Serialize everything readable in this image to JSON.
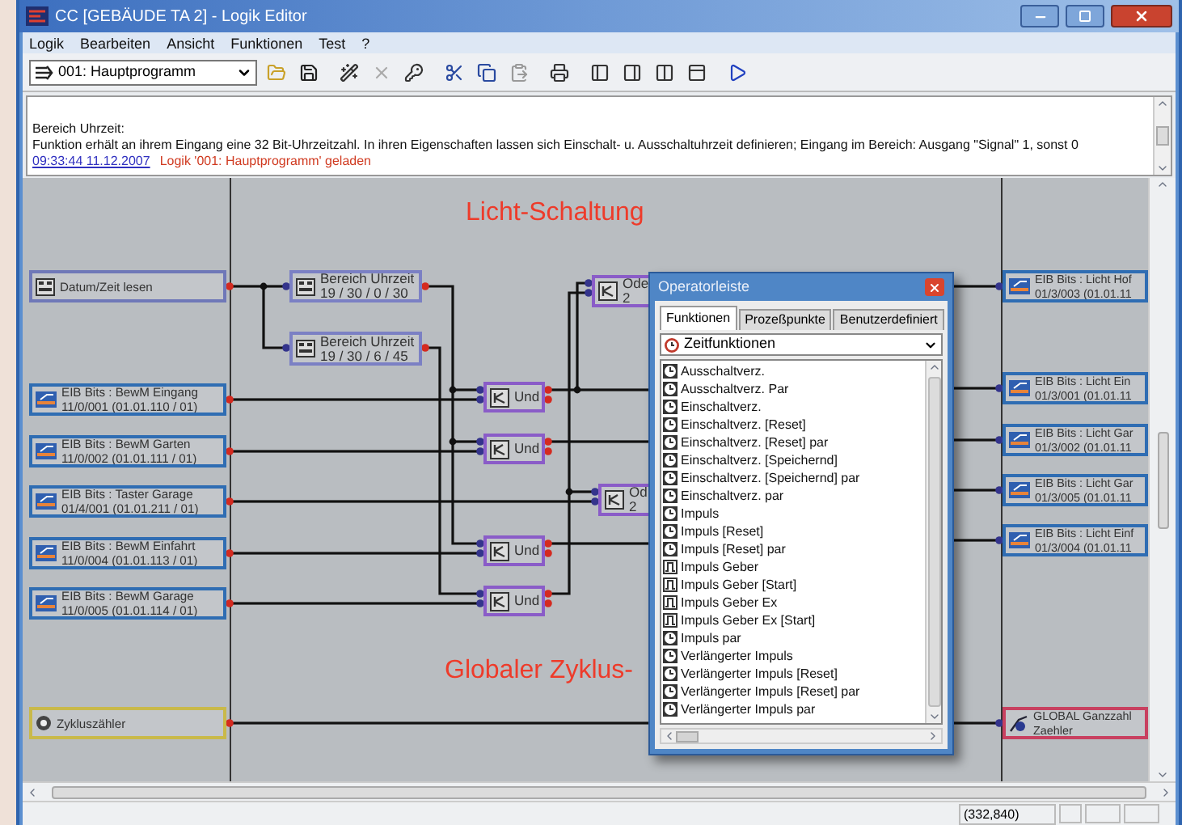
{
  "window": {
    "title": "CC [GEBÄUDE TA 2] - Logik Editor"
  },
  "menu": [
    "Logik",
    "Bearbeiten",
    "Ansicht",
    "Funktionen",
    "Test",
    "?"
  ],
  "toolbar": {
    "program": "001: Hauptprogramm"
  },
  "messages": {
    "heading": "Bereich Uhrzeit:",
    "description": "Funktion erhält an ihrem Eingang eine 32 Bit-Uhrzeitzahl. In ihren Eigenschaften lassen sich Einschalt- u. Ausschaltuhrzeit definieren; Eingang im Bereich: Ausgang \"Signal\" 1, sonst 0",
    "log": [
      {
        "time": "09:33:44 11.12.2007",
        "text": "Logik '001: Hauptprogramm' geladen"
      }
    ]
  },
  "diagram": {
    "section_labels": [
      "Licht-Schaltung",
      "Globaler Zyklus-"
    ],
    "inputs": [
      {
        "kind": "datetime",
        "lines": [
          "Datum/Zeit lesen"
        ]
      },
      {
        "kind": "eib",
        "lines": [
          "EIB Bits : BewM Eingang",
          "11/0/001 (01.01.110 / 01)"
        ]
      },
      {
        "kind": "eib",
        "lines": [
          "EIB Bits : BewM Garten",
          "11/0/002 (01.01.111 / 01)"
        ]
      },
      {
        "kind": "eib",
        "lines": [
          "EIB Bits : Taster Garage",
          "01/4/001 (01.01.211 / 01)"
        ]
      },
      {
        "kind": "eib",
        "lines": [
          "EIB Bits : BewM Einfahrt",
          "11/0/004 (01.01.113 / 01)"
        ]
      },
      {
        "kind": "eib",
        "lines": [
          "EIB Bits : BewM Garage",
          "11/0/005 (01.01.114 / 01)"
        ]
      },
      {
        "kind": "counter",
        "lines": [
          "Zykluszähler"
        ]
      }
    ],
    "blocks": [
      {
        "kind": "time_range",
        "lines": [
          "Bereich Uhrzeit",
          "19 / 30 / 0 / 30"
        ]
      },
      {
        "kind": "time_range",
        "lines": [
          "Bereich Uhrzeit",
          "19 / 30 / 6 / 45"
        ]
      },
      {
        "kind": "and",
        "lines": [
          "Und"
        ]
      },
      {
        "kind": "and",
        "lines": [
          "Und"
        ]
      },
      {
        "kind": "and",
        "lines": [
          "Und"
        ]
      },
      {
        "kind": "and",
        "lines": [
          "Und"
        ]
      },
      {
        "kind": "or",
        "lines": [
          "Ode",
          "2"
        ]
      },
      {
        "kind": "or",
        "lines": [
          "Od",
          "2"
        ]
      }
    ],
    "outputs": [
      {
        "kind": "eib",
        "lines": [
          "EIB Bits : Licht Hof",
          "01/3/003 (01.01.11"
        ]
      },
      {
        "kind": "eib",
        "lines": [
          "EIB Bits : Licht Ein",
          "01/3/001 (01.01.11"
        ]
      },
      {
        "kind": "eib",
        "lines": [
          "EIB Bits : Licht Gar",
          "01/3/002 (01.01.11"
        ]
      },
      {
        "kind": "eib",
        "lines": [
          "EIB Bits : Licht Gar",
          "01/3/005 (01.01.11"
        ]
      },
      {
        "kind": "eib",
        "lines": [
          "EIB Bits : Licht Einf",
          "01/3/004 (01.01.11"
        ]
      },
      {
        "kind": "global",
        "lines": [
          "GLOBAL Ganzzahl",
          "Zaehler"
        ]
      }
    ]
  },
  "operator_panel": {
    "title": "Operatorleiste",
    "tabs": [
      {
        "label": "Funktionen",
        "selected": true
      },
      {
        "label": "Prozeßpunkte",
        "selected": false
      },
      {
        "label": "Benutzerdefiniert",
        "selected": false
      }
    ],
    "category": "Zeitfunktionen",
    "items": [
      {
        "kind": "timer",
        "label": "Ausschaltverz."
      },
      {
        "kind": "timer",
        "label": "Ausschaltverz. Par"
      },
      {
        "kind": "timer",
        "label": "Einschaltverz."
      },
      {
        "kind": "timer",
        "label": "Einschaltverz. [Reset]"
      },
      {
        "kind": "timer",
        "label": "Einschaltverz. [Reset] par"
      },
      {
        "kind": "timer",
        "label": "Einschaltverz. [Speichernd]"
      },
      {
        "kind": "timer",
        "label": "Einschaltverz. [Speichernd] par"
      },
      {
        "kind": "timer",
        "label": "Einschaltverz. par"
      },
      {
        "kind": "timer",
        "label": "Impuls"
      },
      {
        "kind": "timer",
        "label": "Impuls [Reset]"
      },
      {
        "kind": "timer",
        "label": "Impuls [Reset] par"
      },
      {
        "kind": "pulse",
        "label": "Impuls Geber"
      },
      {
        "kind": "pulse",
        "label": "Impuls Geber [Start]"
      },
      {
        "kind": "pulse",
        "label": "Impuls Geber Ex"
      },
      {
        "kind": "pulse",
        "label": "Impuls Geber Ex [Start]"
      },
      {
        "kind": "timer",
        "label": "Impuls par"
      },
      {
        "kind": "timer",
        "label": "Verlängerter Impuls"
      },
      {
        "kind": "timer",
        "label": "Verlängerter Impuls [Reset]"
      },
      {
        "kind": "timer",
        "label": "Verlängerter Impuls [Reset] par"
      },
      {
        "kind": "timer",
        "label": "Verlängerter Impuls par"
      }
    ]
  },
  "status_bar": {
    "coordinates": "(332,840)"
  }
}
